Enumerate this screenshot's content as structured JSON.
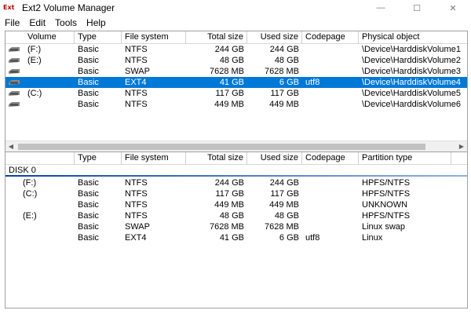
{
  "window": {
    "app_icon": "Ext",
    "title": "Ext2 Volume Manager",
    "btn_min": "—",
    "btn_max": "☐",
    "btn_close": "✕"
  },
  "menu": [
    "File",
    "Edit",
    "Tools",
    "Help"
  ],
  "volumes": {
    "columns": [
      "Volume",
      "Type",
      "File system",
      "Total size",
      "Used size",
      "Codepage",
      "Physical object"
    ],
    "rows": [
      {
        "icon": "drive-icon",
        "volume": "(F:)",
        "type": "Basic",
        "fs": "NTFS",
        "total": "244 GB",
        "used": "244 GB",
        "codepage": "",
        "object": "\\Device\\HarddiskVolume1",
        "selected": false
      },
      {
        "icon": "drive-icon",
        "volume": "(E:)",
        "type": "Basic",
        "fs": "NTFS",
        "total": "48 GB",
        "used": "48 GB",
        "codepage": "",
        "object": "\\Device\\HarddiskVolume2",
        "selected": false
      },
      {
        "icon": "drive-icon",
        "volume": "",
        "type": "Basic",
        "fs": "SWAP",
        "total": "7628 MB",
        "used": "7628 MB",
        "codepage": "",
        "object": "\\Device\\HarddiskVolume3",
        "selected": false
      },
      {
        "icon": "drive-icon",
        "volume": "",
        "type": "Basic",
        "fs": "EXT4",
        "total": "41 GB",
        "used": "6 GB",
        "codepage": "utf8",
        "object": "\\Device\\HarddiskVolume4",
        "selected": true
      },
      {
        "icon": "drive-icon",
        "volume": "(C:)",
        "type": "Basic",
        "fs": "NTFS",
        "total": "117 GB",
        "used": "117 GB",
        "codepage": "",
        "object": "\\Device\\HarddiskVolume5",
        "selected": false
      },
      {
        "icon": "drive-icon",
        "volume": "",
        "type": "Basic",
        "fs": "NTFS",
        "total": "449 MB",
        "used": "449 MB",
        "codepage": "",
        "object": "\\Device\\HarddiskVolume6",
        "selected": false
      }
    ]
  },
  "disks": {
    "columns": [
      "",
      "Type",
      "File system",
      "Total size",
      "Used size",
      "Codepage",
      "Partition type"
    ],
    "disk_label": "DISK 0",
    "rows": [
      {
        "volume": "(F:)",
        "type": "Basic",
        "fs": "NTFS",
        "total": "244 GB",
        "used": "244 GB",
        "codepage": "",
        "ptype": "HPFS/NTFS"
      },
      {
        "volume": "(C:)",
        "type": "Basic",
        "fs": "NTFS",
        "total": "117 GB",
        "used": "117 GB",
        "codepage": "",
        "ptype": "HPFS/NTFS"
      },
      {
        "volume": "",
        "type": "Basic",
        "fs": "NTFS",
        "total": "449 MB",
        "used": "449 MB",
        "codepage": "",
        "ptype": "UNKNOWN"
      },
      {
        "volume": "(E:)",
        "type": "Basic",
        "fs": "NTFS",
        "total": "48 GB",
        "used": "48 GB",
        "codepage": "",
        "ptype": "HPFS/NTFS"
      },
      {
        "volume": "",
        "type": "Basic",
        "fs": "SWAP",
        "total": "7628 MB",
        "used": "7628 MB",
        "codepage": "",
        "ptype": "Linux swap"
      },
      {
        "volume": "",
        "type": "Basic",
        "fs": "EXT4",
        "total": "41 GB",
        "used": "6 GB",
        "codepage": "utf8",
        "ptype": "Linux"
      }
    ]
  },
  "colors": {
    "selection": "#0078d7",
    "disk_line": "#0c3fa8"
  }
}
